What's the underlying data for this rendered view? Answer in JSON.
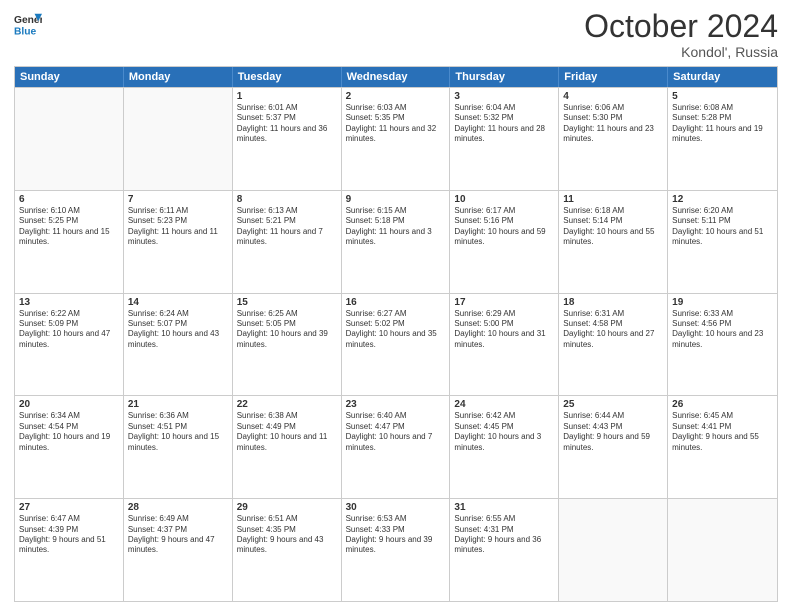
{
  "header": {
    "logo_general": "General",
    "logo_blue": "Blue",
    "month_title": "October 2024",
    "subtitle": "Kondol', Russia"
  },
  "weekdays": [
    "Sunday",
    "Monday",
    "Tuesday",
    "Wednesday",
    "Thursday",
    "Friday",
    "Saturday"
  ],
  "rows": [
    [
      {
        "day": "",
        "info": "",
        "empty": true
      },
      {
        "day": "",
        "info": "",
        "empty": true
      },
      {
        "day": "1",
        "info": "Sunrise: 6:01 AM\nSunset: 5:37 PM\nDaylight: 11 hours and 36 minutes.",
        "empty": false
      },
      {
        "day": "2",
        "info": "Sunrise: 6:03 AM\nSunset: 5:35 PM\nDaylight: 11 hours and 32 minutes.",
        "empty": false
      },
      {
        "day": "3",
        "info": "Sunrise: 6:04 AM\nSunset: 5:32 PM\nDaylight: 11 hours and 28 minutes.",
        "empty": false
      },
      {
        "day": "4",
        "info": "Sunrise: 6:06 AM\nSunset: 5:30 PM\nDaylight: 11 hours and 23 minutes.",
        "empty": false
      },
      {
        "day": "5",
        "info": "Sunrise: 6:08 AM\nSunset: 5:28 PM\nDaylight: 11 hours and 19 minutes.",
        "empty": false
      }
    ],
    [
      {
        "day": "6",
        "info": "Sunrise: 6:10 AM\nSunset: 5:25 PM\nDaylight: 11 hours and 15 minutes.",
        "empty": false
      },
      {
        "day": "7",
        "info": "Sunrise: 6:11 AM\nSunset: 5:23 PM\nDaylight: 11 hours and 11 minutes.",
        "empty": false
      },
      {
        "day": "8",
        "info": "Sunrise: 6:13 AM\nSunset: 5:21 PM\nDaylight: 11 hours and 7 minutes.",
        "empty": false
      },
      {
        "day": "9",
        "info": "Sunrise: 6:15 AM\nSunset: 5:18 PM\nDaylight: 11 hours and 3 minutes.",
        "empty": false
      },
      {
        "day": "10",
        "info": "Sunrise: 6:17 AM\nSunset: 5:16 PM\nDaylight: 10 hours and 59 minutes.",
        "empty": false
      },
      {
        "day": "11",
        "info": "Sunrise: 6:18 AM\nSunset: 5:14 PM\nDaylight: 10 hours and 55 minutes.",
        "empty": false
      },
      {
        "day": "12",
        "info": "Sunrise: 6:20 AM\nSunset: 5:11 PM\nDaylight: 10 hours and 51 minutes.",
        "empty": false
      }
    ],
    [
      {
        "day": "13",
        "info": "Sunrise: 6:22 AM\nSunset: 5:09 PM\nDaylight: 10 hours and 47 minutes.",
        "empty": false
      },
      {
        "day": "14",
        "info": "Sunrise: 6:24 AM\nSunset: 5:07 PM\nDaylight: 10 hours and 43 minutes.",
        "empty": false
      },
      {
        "day": "15",
        "info": "Sunrise: 6:25 AM\nSunset: 5:05 PM\nDaylight: 10 hours and 39 minutes.",
        "empty": false
      },
      {
        "day": "16",
        "info": "Sunrise: 6:27 AM\nSunset: 5:02 PM\nDaylight: 10 hours and 35 minutes.",
        "empty": false
      },
      {
        "day": "17",
        "info": "Sunrise: 6:29 AM\nSunset: 5:00 PM\nDaylight: 10 hours and 31 minutes.",
        "empty": false
      },
      {
        "day": "18",
        "info": "Sunrise: 6:31 AM\nSunset: 4:58 PM\nDaylight: 10 hours and 27 minutes.",
        "empty": false
      },
      {
        "day": "19",
        "info": "Sunrise: 6:33 AM\nSunset: 4:56 PM\nDaylight: 10 hours and 23 minutes.",
        "empty": false
      }
    ],
    [
      {
        "day": "20",
        "info": "Sunrise: 6:34 AM\nSunset: 4:54 PM\nDaylight: 10 hours and 19 minutes.",
        "empty": false
      },
      {
        "day": "21",
        "info": "Sunrise: 6:36 AM\nSunset: 4:51 PM\nDaylight: 10 hours and 15 minutes.",
        "empty": false
      },
      {
        "day": "22",
        "info": "Sunrise: 6:38 AM\nSunset: 4:49 PM\nDaylight: 10 hours and 11 minutes.",
        "empty": false
      },
      {
        "day": "23",
        "info": "Sunrise: 6:40 AM\nSunset: 4:47 PM\nDaylight: 10 hours and 7 minutes.",
        "empty": false
      },
      {
        "day": "24",
        "info": "Sunrise: 6:42 AM\nSunset: 4:45 PM\nDaylight: 10 hours and 3 minutes.",
        "empty": false
      },
      {
        "day": "25",
        "info": "Sunrise: 6:44 AM\nSunset: 4:43 PM\nDaylight: 9 hours and 59 minutes.",
        "empty": false
      },
      {
        "day": "26",
        "info": "Sunrise: 6:45 AM\nSunset: 4:41 PM\nDaylight: 9 hours and 55 minutes.",
        "empty": false
      }
    ],
    [
      {
        "day": "27",
        "info": "Sunrise: 6:47 AM\nSunset: 4:39 PM\nDaylight: 9 hours and 51 minutes.",
        "empty": false
      },
      {
        "day": "28",
        "info": "Sunrise: 6:49 AM\nSunset: 4:37 PM\nDaylight: 9 hours and 47 minutes.",
        "empty": false
      },
      {
        "day": "29",
        "info": "Sunrise: 6:51 AM\nSunset: 4:35 PM\nDaylight: 9 hours and 43 minutes.",
        "empty": false
      },
      {
        "day": "30",
        "info": "Sunrise: 6:53 AM\nSunset: 4:33 PM\nDaylight: 9 hours and 39 minutes.",
        "empty": false
      },
      {
        "day": "31",
        "info": "Sunrise: 6:55 AM\nSunset: 4:31 PM\nDaylight: 9 hours and 36 minutes.",
        "empty": false
      },
      {
        "day": "",
        "info": "",
        "empty": true
      },
      {
        "day": "",
        "info": "",
        "empty": true
      }
    ]
  ]
}
